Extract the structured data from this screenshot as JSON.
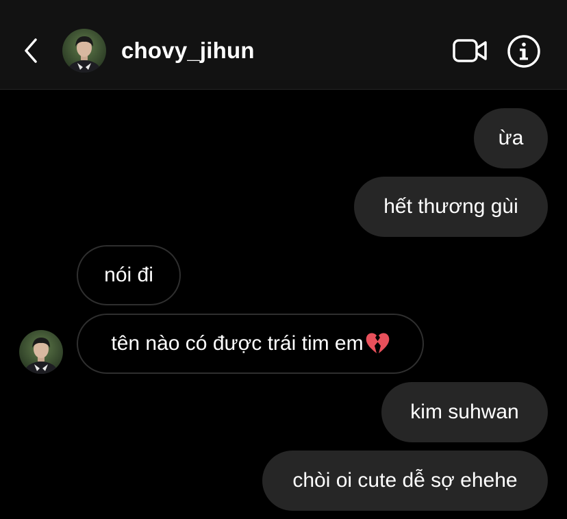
{
  "header": {
    "username": "chovy_jihun",
    "back_icon": "chevron-left-icon",
    "video_icon": "video-camera-icon",
    "info_icon": "info-icon"
  },
  "messages": [
    {
      "direction": "sent",
      "text": "ừa"
    },
    {
      "direction": "sent",
      "text": "hết thương gùi"
    },
    {
      "direction": "received",
      "text": "nói đi"
    },
    {
      "direction": "received",
      "text": "tên nào có được trái tim em",
      "emoji": "broken-heart-icon"
    },
    {
      "direction": "sent",
      "text": "kim suhwan"
    },
    {
      "direction": "sent",
      "text": "chòi oi cute dễ sợ ehehe"
    }
  ],
  "colors": {
    "background": "#000000",
    "header_bg": "#121212",
    "sent_bubble": "#262626",
    "received_border": "#2f2f2f",
    "text": "#ffffff",
    "broken_heart": "#e8505b"
  }
}
